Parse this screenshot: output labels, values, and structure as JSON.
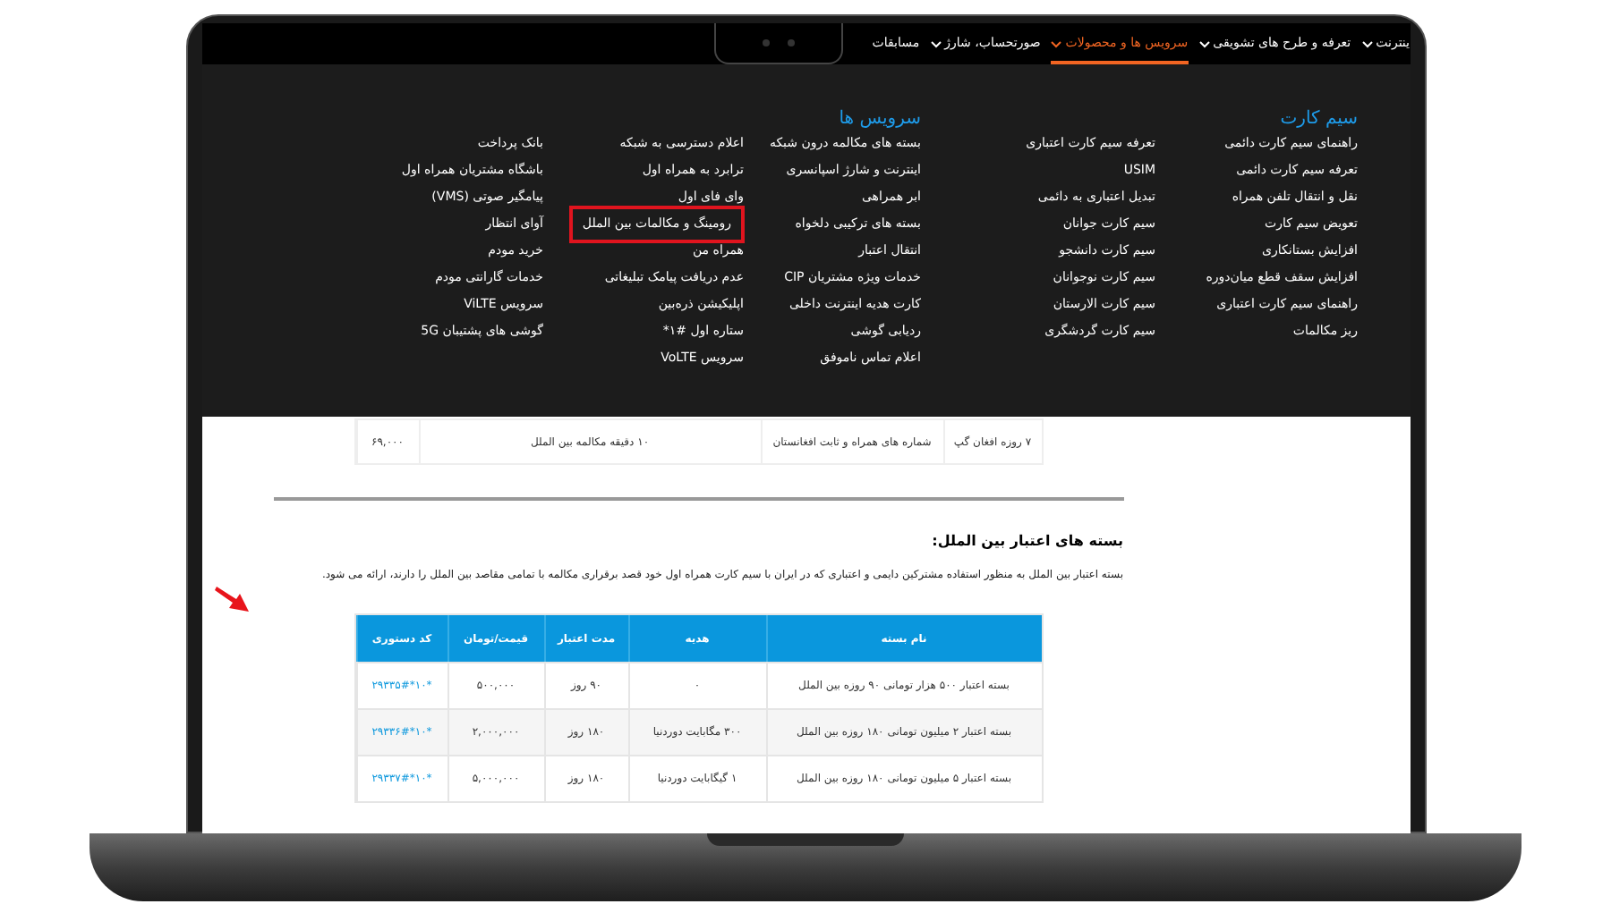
{
  "nav": {
    "items": [
      {
        "label": "ینترنت",
        "selected": false,
        "has_menu": true
      },
      {
        "label": "تعرفه و طرح های تشویقی",
        "selected": false,
        "has_menu": true
      },
      {
        "label": "سرویس ها و محصولات",
        "selected": true,
        "has_menu": true
      },
      {
        "label": "صورتحساب، شارژ",
        "selected": false,
        "has_menu": true
      },
      {
        "label": "مسابقات",
        "selected": false,
        "has_menu": false
      }
    ]
  },
  "mega_menu": {
    "columns": [
      {
        "heading": "سیم کارت",
        "items": [
          {
            "label": "راهنمای سیم کارت دائمی",
            "highlighted": false
          },
          {
            "label": "تعرفه سیم کارت دائمی",
            "highlighted": false
          },
          {
            "label": "نقل و انتقال تلفن همراه",
            "highlighted": false
          },
          {
            "label": "تعویض سیم کارت",
            "highlighted": false
          },
          {
            "label": "افزایش بستانکاری",
            "highlighted": false
          },
          {
            "label": "افزایش سقف قطع میان‌دوره",
            "highlighted": false
          },
          {
            "label": "راهنمای سیم کارت اعتباری",
            "highlighted": false
          },
          {
            "label": "ریز مکالمات",
            "highlighted": false
          }
        ]
      },
      {
        "items": [
          {
            "label": "تعرفه سیم کارت اعتباری",
            "highlighted": false
          },
          {
            "label": "USIM",
            "highlighted": false
          },
          {
            "label": "تبدیل اعتباری به دائمی",
            "highlighted": false
          },
          {
            "label": "سیم کارت جوانان",
            "highlighted": false
          },
          {
            "label": "سیم کارت دانشجو",
            "highlighted": false
          },
          {
            "label": "سیم کارت نوجوانان",
            "highlighted": false
          },
          {
            "label": "سیم کارت الارستان",
            "highlighted": false
          },
          {
            "label": "سیم کارت گردشگری",
            "highlighted": false
          }
        ]
      },
      {
        "heading": "سرویس ها",
        "items": [
          {
            "label": "بسته های مکالمه درون شبکه",
            "highlighted": false
          },
          {
            "label": "اینترنت و شارژ اسپانسری",
            "highlighted": false
          },
          {
            "label": "ابر همراهی",
            "highlighted": false
          },
          {
            "label": "بسته های ترکیبی دلخواه",
            "highlighted": false
          },
          {
            "label": "انتقال اعتبار",
            "highlighted": false
          },
          {
            "label": "خدمات ویژه مشتریان CIP",
            "highlighted": false
          },
          {
            "label": "کارت هدیه اینترنت داخلی",
            "highlighted": false
          },
          {
            "label": "ردیابی گوشی",
            "highlighted": false
          },
          {
            "label": "اعلام تماس ناموفق",
            "highlighted": false
          }
        ]
      },
      {
        "items": [
          {
            "label": "اعلام دسترسی به شبکه",
            "highlighted": false
          },
          {
            "label": "ترابرد به همراه اول",
            "highlighted": false
          },
          {
            "label": "وای فای اول",
            "highlighted": false
          },
          {
            "label": "رومینگ و مکالمات بین الملل",
            "highlighted": true
          },
          {
            "label": "همراه من",
            "highlighted": false
          },
          {
            "label": "عدم دریافت پیامک تبلیغاتی",
            "highlighted": false
          },
          {
            "label": "اپلیکیشن ذره‌بین",
            "highlighted": false
          },
          {
            "label": "ستاره اول #۱*",
            "highlighted": false
          },
          {
            "label": "سرویس VoLTE",
            "highlighted": false
          }
        ]
      },
      {
        "items": [
          {
            "label": "بانک پرداخت",
            "highlighted": false
          },
          {
            "label": "باشگاه مشتریان همراه اول",
            "highlighted": false
          },
          {
            "label": "پیامگیر صوتی (VMS)",
            "highlighted": false
          },
          {
            "label": "آوای انتظار",
            "highlighted": false
          },
          {
            "label": "خرید مودم",
            "highlighted": false
          },
          {
            "label": "خدمات گارانتی مودم",
            "highlighted": false
          },
          {
            "label": "سرویس ViLTE",
            "highlighted": false
          },
          {
            "label": "گوشی های پشتیبان 5G",
            "highlighted": false
          }
        ]
      }
    ]
  },
  "previous_table": {
    "rows": [
      {
        "cells": [
          "۷ روزه افغان گپ",
          "شماره های همراه و ثابت افغانستان",
          "۱۰ دقیقه مکالمه بین الملل",
          "۶۹,۰۰۰"
        ]
      }
    ]
  },
  "section": {
    "heading": "بسته های اعتبار بین الملل:",
    "paragraph": "بسته اعتبار بین الملل به منظور استفاده مشترکین دایمی و اعتباری که در ایران با سیم کارت همراه اول خود قصد برقراری مکالمه با تمامی مقاصد بین الملل را دارند، ارائه می شود."
  },
  "table": {
    "columns": [
      "نام بسته",
      "هدیه",
      "مدت اعتبار",
      "قیمت/تومان",
      "کد دستوری"
    ],
    "rows": [
      {
        "cells": [
          "بسته اعتبار ۵۰۰ هزار تومانی ۹۰ روزه بین الملل",
          "۰",
          "۹۰ روز",
          "۵۰۰,۰۰۰",
          "*۱۰*۲۹۳۳۵#"
        ]
      },
      {
        "cells": [
          "بسته اعتبار ۲ میلیون تومانی ۱۸۰ روزه بین الملل",
          "۳۰۰ مگابایت دوردنیا",
          "۱۸۰ روز",
          "۲,۰۰۰,۰۰۰",
          "*۱۰*۲۹۳۳۶#"
        ]
      },
      {
        "cells": [
          "بسته اعتبار ۵ میلیون تومانی ۱۸۰ روزه بین الملل",
          "۱ گیگابایت دوردنیا",
          "۱۸۰ روز",
          "۵,۰۰۰,۰۰۰",
          "*۱۰*۲۹۳۳۷#"
        ]
      }
    ]
  }
}
